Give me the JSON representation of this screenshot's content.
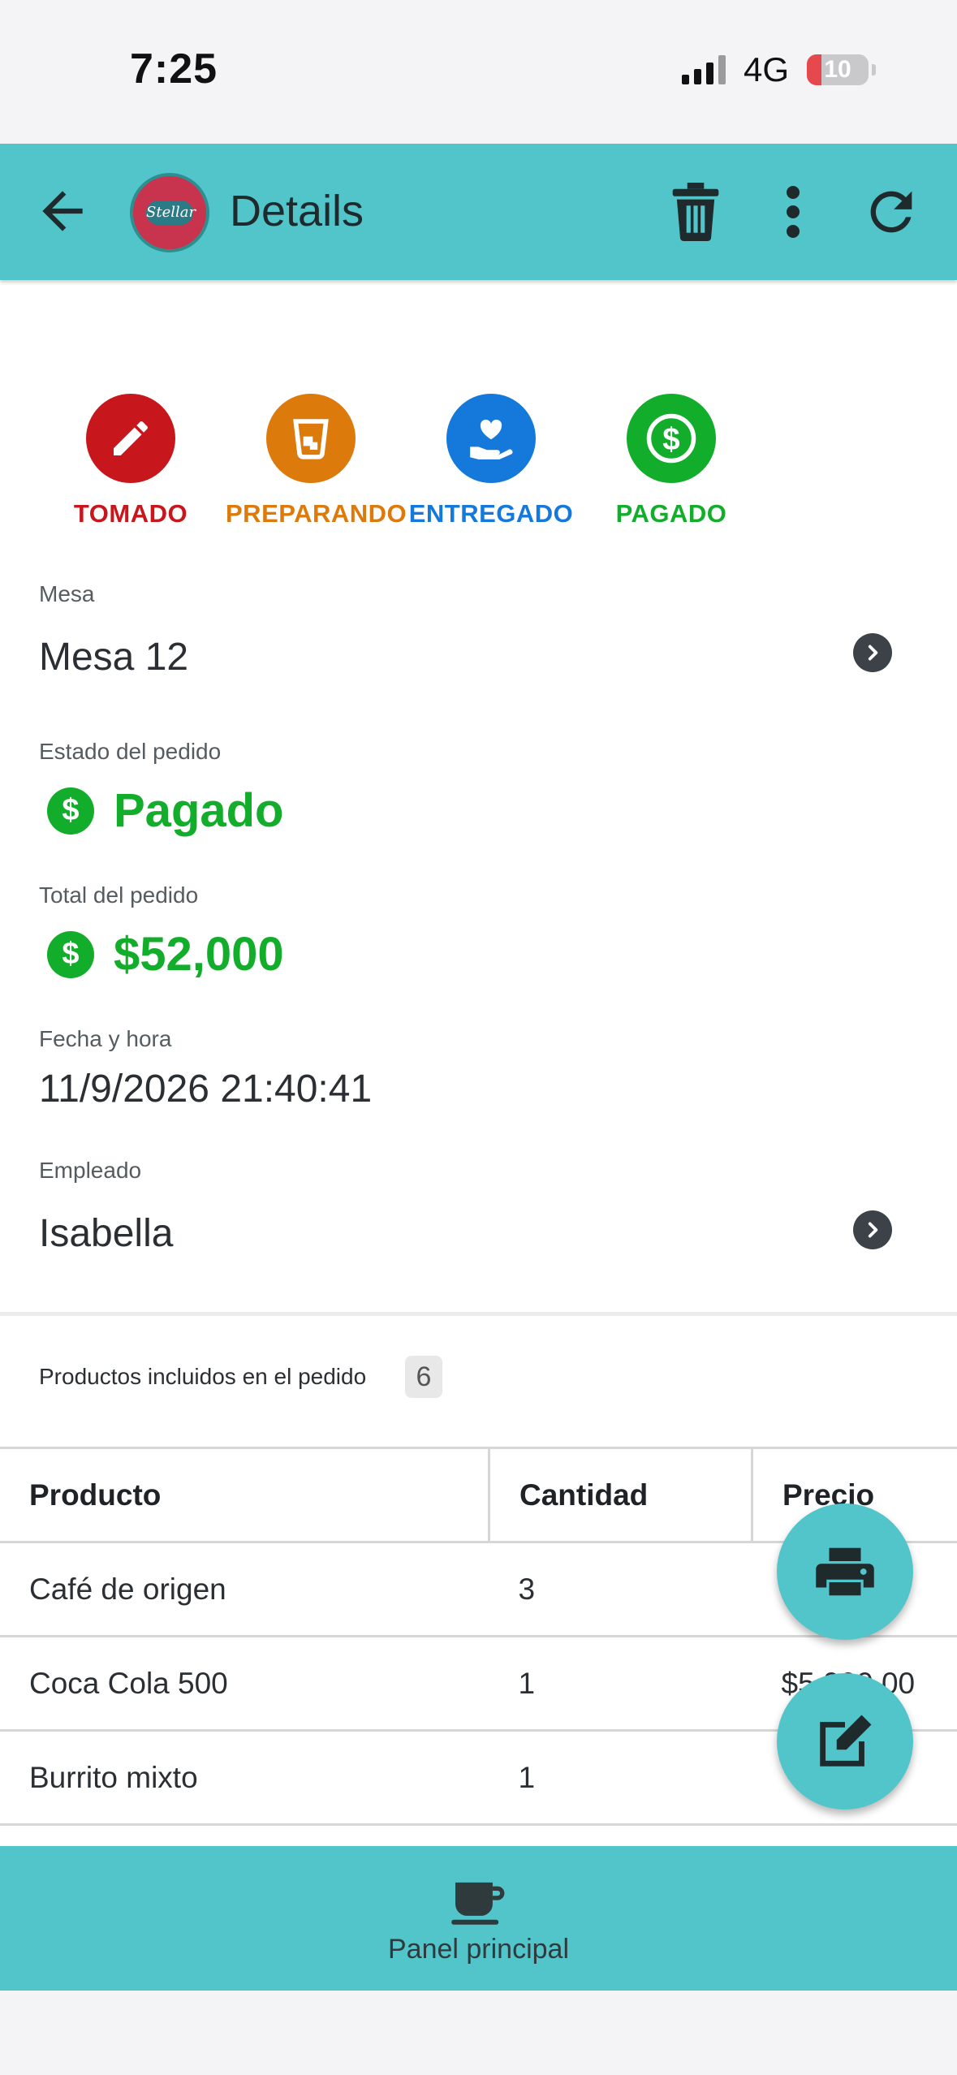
{
  "status_bar": {
    "time": "7:25",
    "network": "4G",
    "battery_level": "10"
  },
  "app_bar": {
    "title": "Details",
    "logo_text": "Stellar"
  },
  "order_status_steps": [
    {
      "label": "TOMADO",
      "color": "#c8161d",
      "icon": "pencil-icon"
    },
    {
      "label": "PREPARANDO",
      "color": "#dc7a0c",
      "icon": "glass-icon"
    },
    {
      "label": "ENTREGADO",
      "color": "#1479db",
      "icon": "hand-heart-icon"
    },
    {
      "label": "PAGADO",
      "color": "#12ad2b",
      "icon": "dollar-icon"
    }
  ],
  "details": {
    "mesa": {
      "label": "Mesa",
      "value": "Mesa 12"
    },
    "estado": {
      "label": "Estado del pedido",
      "value": "Pagado"
    },
    "total": {
      "label": "Total del pedido",
      "value": "$52,000"
    },
    "fecha": {
      "label": "Fecha y hora",
      "value": "11/9/2026 21:40:41"
    },
    "empleado": {
      "label": "Empleado",
      "value": "Isabella"
    }
  },
  "products": {
    "label": "Productos incluidos en el pedido",
    "count": "6",
    "columns": [
      "Producto",
      "Cantidad",
      "Precio"
    ],
    "rows": [
      {
        "producto": "Café de origen",
        "cantidad": "3",
        "precio": ""
      },
      {
        "producto": "Coca Cola 500",
        "cantidad": "1",
        "precio": "$5,000.00"
      },
      {
        "producto": "Burrito mixto",
        "cantidad": "1",
        "precio": ""
      }
    ]
  },
  "bottom_nav": {
    "label": "Panel principal",
    "icon": "coffee-cup-icon"
  },
  "colors": {
    "accent": "#52c5cb",
    "paid_green": "#12ad2b"
  }
}
